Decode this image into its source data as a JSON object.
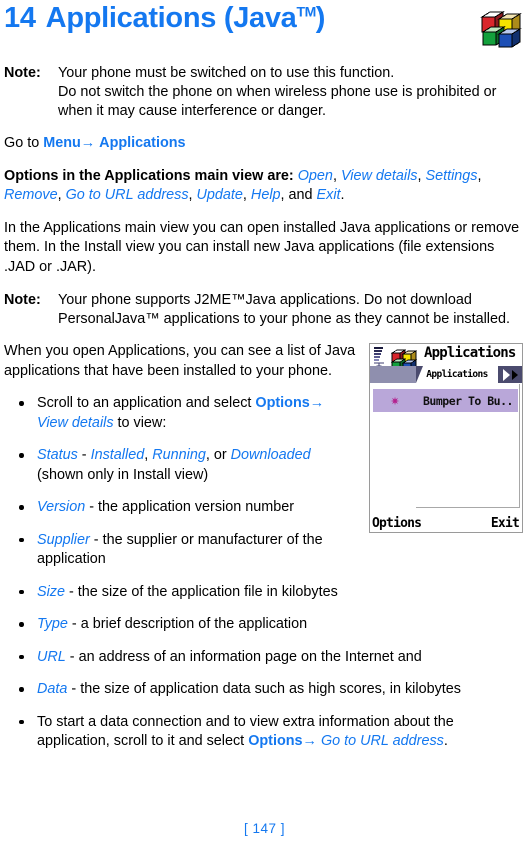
{
  "chapter": {
    "number": "14",
    "title": "Applications (Java",
    "tm": "TM",
    "title_close": ")"
  },
  "colors": {
    "accent_blue": "#1478f0",
    "body_text": "#000000",
    "phone_highlight": "#b9a7d9",
    "phone_tabbar": "#4b4b6e",
    "star": "#b3218e"
  },
  "note1": {
    "label": "Note:",
    "line1": "Your phone must be switched on to use this function.",
    "line2": "Do not switch the phone on when wireless phone use is prohibited or when it may cause interference or danger."
  },
  "goto": {
    "prefix": "Go to ",
    "menu": "Menu",
    "arrow": "→",
    "applications": "Applications"
  },
  "options_para": {
    "lead": "Options in the Applications main view are:",
    "items": [
      "Open",
      "View details",
      "Settings",
      "Remove",
      "Go to URL address",
      "Update",
      "Help"
    ],
    "and": "and",
    "last": "Exit",
    "period": "."
  },
  "install_para": "In the Applications main view you can open installed Java applications or remove them. In the Install view you can install new Java applications (file extensions .JAD or .JAR).",
  "note2": {
    "label": "Note:",
    "body": "Your phone supports J2ME™Java applications. Do not download PersonalJava™ applications to your phone as they cannot be installed."
  },
  "open_para": "When you open Applications, you can see a list of Java applications that have been installed to your phone.",
  "phone_screenshot": {
    "title": "Applications",
    "tab_label": "Applications",
    "row_label": "Bumper To Bu..",
    "softkey_left": "Options",
    "softkey_right": "Exit",
    "star_glyph": "✷",
    "icons": {
      "signal": "signal-bars-icon",
      "app": "java-blocks-icon",
      "tab_arrow": "tab-next-arrow-icon"
    }
  },
  "bullets": [
    {
      "id": "scroll-select",
      "segments": [
        {
          "t": "Scroll to an application and select ",
          "s": "plain"
        },
        {
          "t": "Options",
          "s": "blue-b"
        },
        {
          "t": "→ ",
          "s": "blue-b"
        },
        {
          "t": "View details",
          "s": "blue-i"
        },
        {
          "t": " to view:",
          "s": "plain"
        }
      ]
    },
    {
      "id": "status",
      "segments": [
        {
          "t": "Status",
          "s": "blue-i"
        },
        {
          "t": " - ",
          "s": "plain"
        },
        {
          "t": "Installed",
          "s": "blue-i"
        },
        {
          "t": ", ",
          "s": "plain"
        },
        {
          "t": "Running",
          "s": "blue-i"
        },
        {
          "t": ", or ",
          "s": "plain"
        },
        {
          "t": "Downloaded",
          "s": "blue-i"
        },
        {
          "t": " (shown only in Install view)",
          "s": "plain"
        }
      ]
    },
    {
      "id": "version",
      "segments": [
        {
          "t": "Version",
          "s": "blue-i"
        },
        {
          "t": " - the application version number",
          "s": "plain"
        }
      ]
    },
    {
      "id": "supplier",
      "segments": [
        {
          "t": "Supplier",
          "s": "blue-i"
        },
        {
          "t": " - the supplier or manufacturer of the application",
          "s": "plain"
        }
      ]
    },
    {
      "id": "size",
      "segments": [
        {
          "t": "Size",
          "s": "blue-i"
        },
        {
          "t": " - the size of the application file in kilobytes",
          "s": "plain"
        }
      ]
    },
    {
      "id": "type",
      "segments": [
        {
          "t": "Type",
          "s": "blue-i"
        },
        {
          "t": " - a brief description of the application",
          "s": "plain"
        }
      ]
    },
    {
      "id": "url",
      "segments": [
        {
          "t": "URL",
          "s": "blue-i"
        },
        {
          "t": " - an address of an information page on the Internet and",
          "s": "plain"
        }
      ]
    },
    {
      "id": "data",
      "segments": [
        {
          "t": "Data",
          "s": "blue-i"
        },
        {
          "t": " - the size of application data such as high scores, in kilobytes",
          "s": "plain"
        }
      ]
    },
    {
      "id": "data-connection",
      "segments": [
        {
          "t": "To start a data connection and to view extra information about the application, scroll to it and select ",
          "s": "plain"
        },
        {
          "t": "Options",
          "s": "blue-b"
        },
        {
          "t": "→ ",
          "s": "blue-b"
        },
        {
          "t": "Go to URL address",
          "s": "blue-i"
        },
        {
          "t": ".",
          "s": "plain"
        }
      ]
    }
  ],
  "footer": {
    "page_number": "[ 147 ]"
  }
}
